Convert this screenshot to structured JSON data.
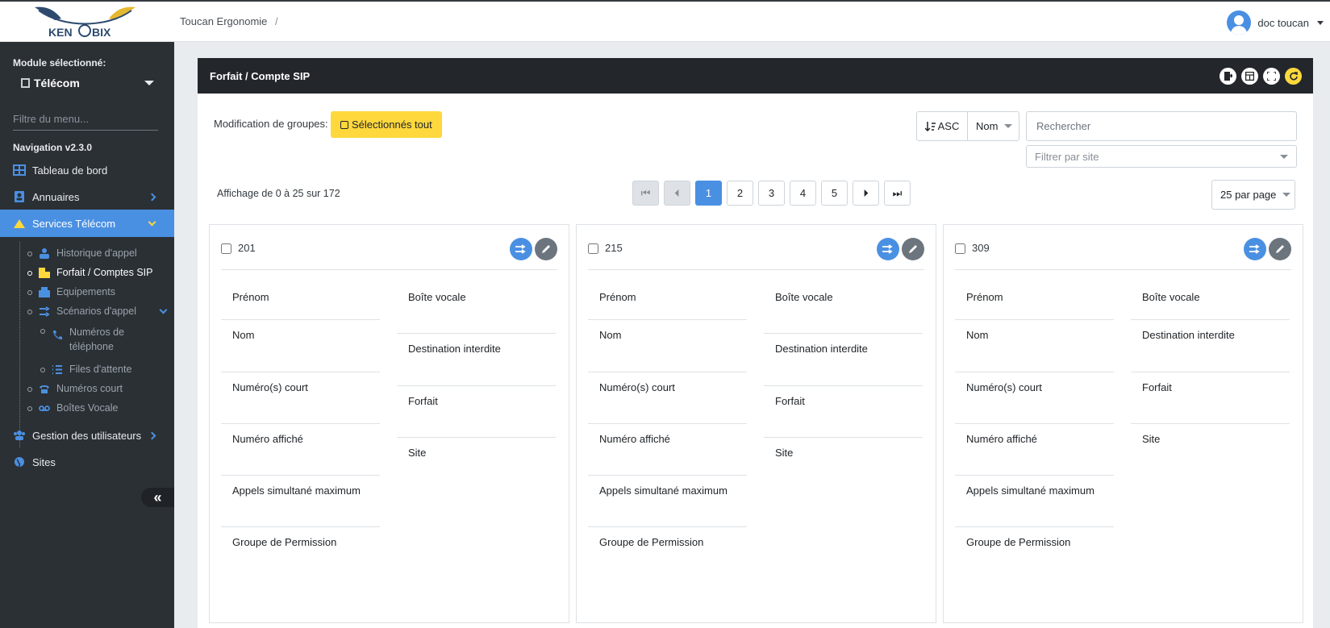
{
  "header": {
    "logo_text": "KENOBIX",
    "breadcrumb": "Toucan Ergonomie",
    "breadcrumb_sep": "/",
    "user_name": "doc toucan"
  },
  "sidebar": {
    "module_label": "Module sélectionné:",
    "module_value": "Télécom",
    "filter_placeholder": "Filtre du menu...",
    "version": "Navigation v2.3.0",
    "items": [
      {
        "label": "Tableau de bord",
        "icon": "dashboard-icon"
      },
      {
        "label": "Annuaires",
        "icon": "contacts-icon"
      },
      {
        "label": "Services Télécom",
        "icon": "telecom-icon"
      },
      {
        "label": "Gestion des utilisateurs",
        "icon": "users-icon"
      },
      {
        "label": "Sites",
        "icon": "globe-icon"
      }
    ],
    "sub_items": [
      {
        "label": "Historique d'appel"
      },
      {
        "label": "Forfait / Comptes SIP"
      },
      {
        "label": "Equipements"
      },
      {
        "label": "Scénarios d'appel"
      },
      {
        "label": "Numéros de téléphone"
      },
      {
        "label": "Files d'attente"
      },
      {
        "label": "Numéros court"
      },
      {
        "label": "Boîtes Vocale"
      }
    ],
    "colors": {
      "bg": "#2b3035",
      "active": "#4a90e2",
      "accent": "#ffd83d"
    }
  },
  "panel": {
    "title": "Forfait / Compte SIP",
    "group_label": "Modification de groupes:",
    "select_all": "Sélectionnés tout",
    "sort_dir": "ASC",
    "sort_field": "Nom",
    "search_placeholder": "Rechercher",
    "site_filter_placeholder": "Filtrer par site",
    "showing": "Affichage de 0 à 25 sur 172",
    "pages": [
      "1",
      "2",
      "3",
      "4",
      "5"
    ],
    "current_page": "1",
    "per_page": "25 par page"
  },
  "field_labels": {
    "prenom": "Prénom",
    "nom": "Nom",
    "numeros_court": "Numéro(s) court",
    "numero_affiche": "Numéro affiché",
    "appels": "Appels simultané maximum",
    "groupe": "Groupe de Permission",
    "boite_vocale": "Boîte vocale",
    "destination": "Destination interdite",
    "forfait": "Forfait",
    "site": "Site"
  },
  "cards": [
    {
      "number": "201"
    },
    {
      "number": "215"
    },
    {
      "number": "309"
    }
  ]
}
